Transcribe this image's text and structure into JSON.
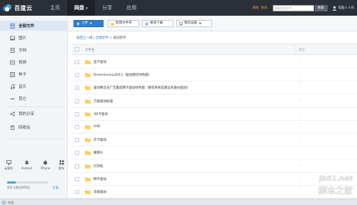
{
  "app": {
    "logo_text": "百度云"
  },
  "nav": {
    "items": [
      {
        "label": "主页"
      },
      {
        "label": "网盘"
      },
      {
        "label": "分享"
      },
      {
        "label": "应用"
      }
    ]
  },
  "top_right": {
    "link1": "通知",
    "link2": "更多",
    "search_placeholder": "搜索您的文件",
    "search_button": "搜索",
    "user": "电脑人人有"
  },
  "sidebar": {
    "items": [
      {
        "label": "全部文件"
      },
      {
        "label": "图片"
      },
      {
        "label": "文档"
      },
      {
        "label": "视频"
      },
      {
        "label": "种子"
      },
      {
        "label": "音乐"
      },
      {
        "label": "其它"
      },
      {
        "label": "我的分享"
      },
      {
        "label": "回收站"
      }
    ],
    "devices": [
      {
        "label": "云管家"
      },
      {
        "label": "Android"
      },
      {
        "label": "iPhone"
      },
      {
        "label": "更多"
      }
    ],
    "quota_text": "431.14G/2055G",
    "quota_link": "扩容",
    "quota_fraction": 0.21
  },
  "toolbar": {
    "upload": "上传",
    "new_folder": "新建文件夹",
    "offline": "离线下载",
    "devices": "我的设备"
  },
  "breadcrumb": {
    "back": "返回上一级",
    "sep1": "|",
    "all": "全部文件",
    "sep2": ">",
    "current": "驱动程序"
  },
  "list": {
    "col_name": "文件名",
    "col_size": "大小",
    "rows": [
      {
        "name": "显卡驱动",
        "size": "-"
      },
      {
        "name": "DriverGenius2013（驱动精灵绿色版）",
        "size": "-"
      },
      {
        "name": "驱动精灵去广告集成网卡驱动绿色版（重装系统前建议先备份驱动）",
        "size": "-"
      },
      {
        "name": "万能驱动助理",
        "size": "-"
      },
      {
        "name": "3D卡驱动",
        "size": "-"
      },
      {
        "name": "USB",
        "size": "-"
      },
      {
        "name": "声卡驱动",
        "size": "-"
      },
      {
        "name": "摄像头",
        "size": "-"
      },
      {
        "name": "打印机",
        "size": "-"
      },
      {
        "name": "网卡驱动",
        "size": "-"
      },
      {
        "name": "华硕驱动",
        "size": "-"
      }
    ]
  },
  "status": {
    "text": "完成"
  },
  "watermark": {
    "site": "jb51.net",
    "text": "脚本之家"
  },
  "colors": {
    "topbar": "#2b3038",
    "primary": "#2f7fd1",
    "folder": "#f5c242"
  }
}
